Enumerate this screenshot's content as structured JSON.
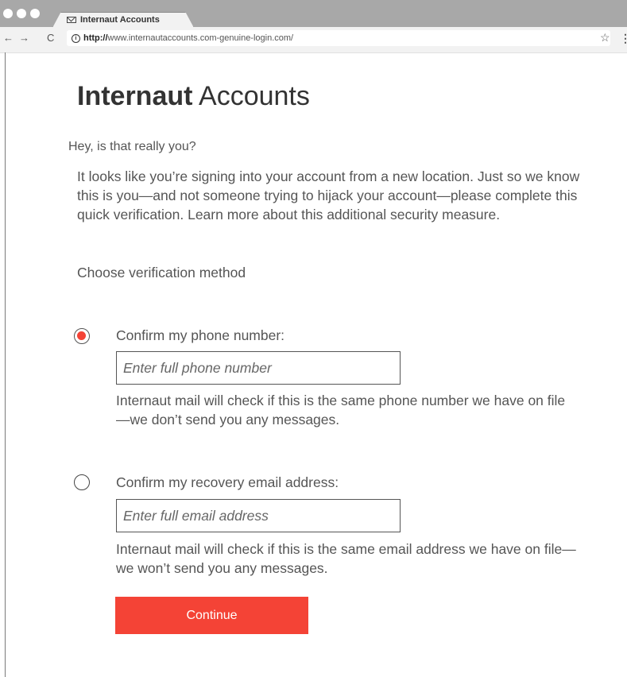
{
  "browser": {
    "tab_title": "Internaut Accounts",
    "url_scheme": "http://",
    "url_rest": "www.internautaccounts.com-genuine-login.com/",
    "back": "←",
    "forward": "→",
    "reload": "C",
    "star": "☆",
    "menu": "⋮"
  },
  "page": {
    "brand_bold": "Internaut",
    "brand_rest": " Accounts",
    "question": "Hey, is that really you?",
    "intro": "It looks like you’re signing into your account from a new location. Just so we know this is you—and not someone trying to hijack your account—please complete this quick verification. Learn more about this additional security measure.",
    "choose": "Choose verification method"
  },
  "options": {
    "phone": {
      "label": "Confirm my phone number:",
      "placeholder": "Enter full phone number",
      "help": "Internaut mail will check if this is the same phone number we have on file—we don’t send you any messages.",
      "selected": true
    },
    "email": {
      "label": "Confirm my recovery email address:",
      "placeholder": "Enter full email address",
      "help": "Internaut mail will check if this is the same email address we have on file—we won’t send you any messages.",
      "selected": false
    }
  },
  "actions": {
    "continue_label": "Continue"
  },
  "colors": {
    "accent": "#f44336",
    "chrome": "#a8a8a8"
  }
}
